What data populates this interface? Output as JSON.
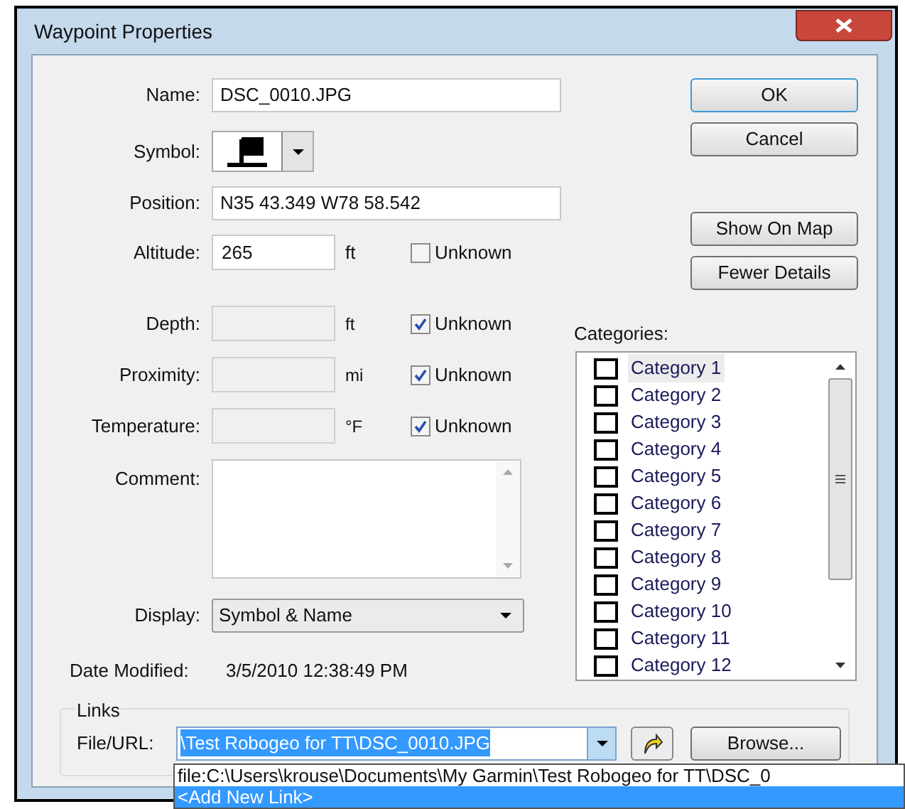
{
  "window": {
    "title": "Waypoint Properties"
  },
  "fields": [
    {
      "kind": "text",
      "label": "Name:",
      "value": "DSC_0010.JPG"
    },
    {
      "kind": "symbol",
      "label": "Symbol:"
    },
    {
      "kind": "text",
      "label": "Position:",
      "value": "N35 43.349 W78 58.542"
    },
    {
      "kind": "measure",
      "label": "Altitude:",
      "value": "265",
      "unit": "ft",
      "disabled": false,
      "unknown": {
        "label": "Unknown",
        "checked": false
      }
    }
  ],
  "measurements": [
    {
      "label": "Depth:",
      "unit": "ft",
      "disabled": true,
      "unknown": {
        "label": "Unknown",
        "checked": true
      }
    },
    {
      "label": "Proximity:",
      "unit": "mi",
      "disabled": true,
      "unknown": {
        "label": "Unknown",
        "checked": true
      }
    },
    {
      "label": "Temperature:",
      "unit": "°F",
      "disabled": true,
      "unknown": {
        "label": "Unknown",
        "checked": true
      }
    }
  ],
  "comment": {
    "label": "Comment:"
  },
  "display": {
    "label": "Display:",
    "value": "Symbol & Name"
  },
  "date_modified": {
    "label": "Date Modified:",
    "value": "3/5/2010 12:38:49 PM"
  },
  "buttons": [
    {
      "label": "OK",
      "default": true
    },
    {
      "label": "Cancel",
      "default": false
    }
  ],
  "view_buttons": [
    {
      "label": "Show On Map"
    },
    {
      "label": "Fewer Details"
    }
  ],
  "categories": {
    "label": "Categories:",
    "items": [
      {
        "label": "Category 1",
        "checked": false,
        "selected": true
      },
      {
        "label": "Category 2",
        "checked": false,
        "selected": false
      },
      {
        "label": "Category 3",
        "checked": false,
        "selected": false
      },
      {
        "label": "Category 4",
        "checked": false,
        "selected": false
      },
      {
        "label": "Category 5",
        "checked": false,
        "selected": false
      },
      {
        "label": "Category 6",
        "checked": false,
        "selected": false
      },
      {
        "label": "Category 7",
        "checked": false,
        "selected": false
      },
      {
        "label": "Category 8",
        "checked": false,
        "selected": false
      },
      {
        "label": "Category 9",
        "checked": false,
        "selected": false
      },
      {
        "label": "Category 10",
        "checked": false,
        "selected": false
      },
      {
        "label": "Category 11",
        "checked": false,
        "selected": false
      },
      {
        "label": "Category 12",
        "checked": false,
        "selected": false
      }
    ]
  },
  "links": {
    "title": "Links",
    "label": "File/URL:",
    "value": "\\Test Robogeo for TT\\DSC_0010.JPG",
    "browse": "Browse...",
    "options": [
      {
        "label": "file:C:\\Users\\krouse\\Documents\\My Garmin\\Test Robogeo for TT\\DSC_0",
        "selected": false
      },
      {
        "label": "<Add New Link>",
        "selected": true
      }
    ]
  }
}
